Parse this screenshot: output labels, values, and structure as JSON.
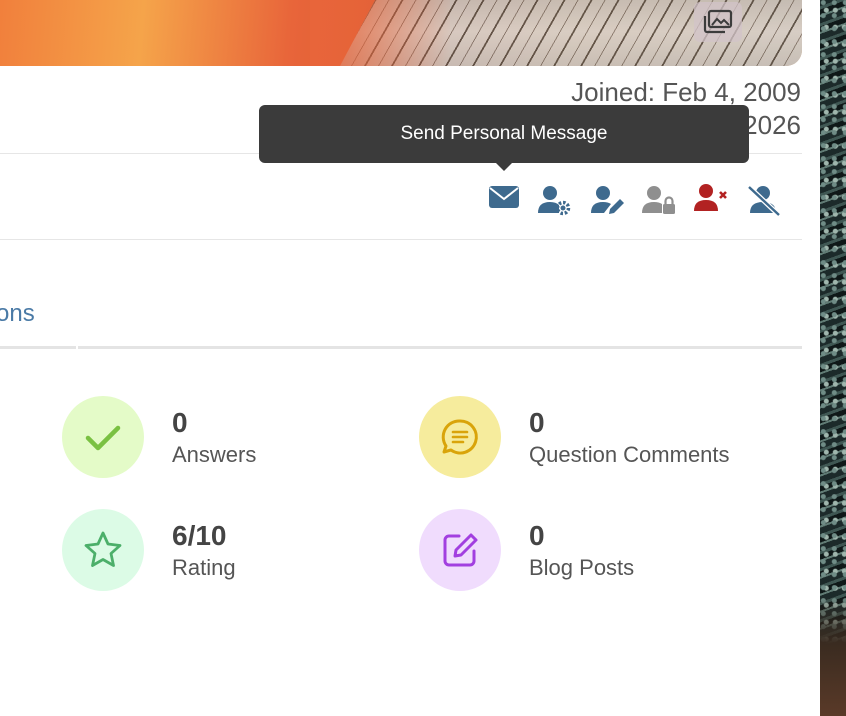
{
  "cover": {
    "photo_button_icon": "gallery-icon"
  },
  "profile_meta": {
    "joined": "Joined: Feb 4, 2009",
    "last_seen_partial": "2026"
  },
  "tooltip": {
    "text": "Send Personal Message"
  },
  "actions": [
    {
      "icon": "envelope-icon",
      "color": "#3e6a8e"
    },
    {
      "icon": "user-gear-icon",
      "color": "#3e6a8e"
    },
    {
      "icon": "user-edit-icon",
      "color": "#3e6a8e"
    },
    {
      "icon": "user-lock-icon",
      "color": "#8f8f8f"
    },
    {
      "icon": "user-remove-icon",
      "color": "#b22222"
    },
    {
      "icon": "user-slash-icon",
      "color": "#3e6a8e"
    }
  ],
  "tabs": {
    "active_partial_label": "ons"
  },
  "stats": {
    "answers": {
      "value": "0",
      "label": "Answers",
      "icon": "check-icon",
      "bg": "#e4fbc8",
      "fg": "#7ac142"
    },
    "question_comments": {
      "value": "0",
      "label": "Question Comments",
      "icon": "comment-icon",
      "bg": "#f6ec9d",
      "fg": "#d9a40a"
    },
    "rating": {
      "value": "6/10",
      "label": "Rating",
      "icon": "star-icon",
      "bg": "#dcfbe6",
      "fg": "#4caf6a"
    },
    "blog_posts": {
      "value": "0",
      "label": "Blog Posts",
      "icon": "edit-icon",
      "bg": "#f0dcfd",
      "fg": "#a23fe0"
    }
  }
}
